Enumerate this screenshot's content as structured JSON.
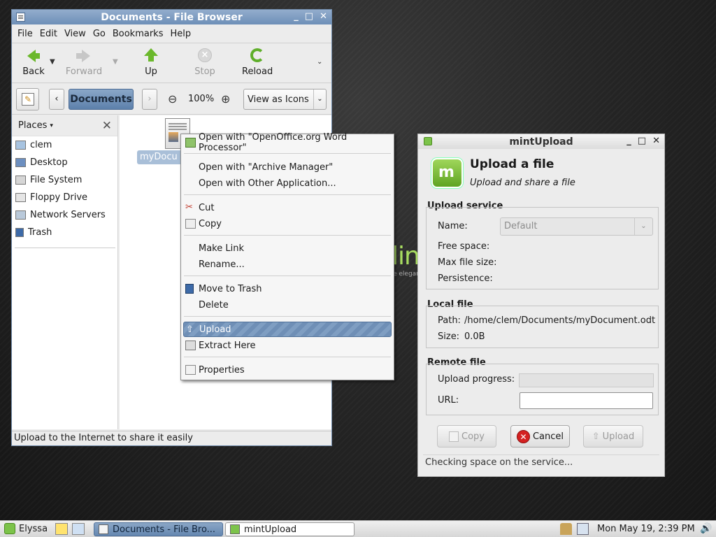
{
  "file_browser": {
    "title": "Documents - File Browser",
    "menu": [
      "File",
      "Edit",
      "View",
      "Go",
      "Bookmarks",
      "Help"
    ],
    "toolbar": {
      "back": "Back",
      "forward": "Forward",
      "up": "Up",
      "stop": "Stop",
      "reload": "Reload"
    },
    "location": {
      "crumb": "Documents",
      "zoom": "100%",
      "view_mode": "View as Icons"
    },
    "sidebar": {
      "header": "Places",
      "items": [
        "clem",
        "Desktop",
        "File System",
        "Floppy Drive",
        "Network Servers",
        "Trash"
      ]
    },
    "file": {
      "name": "myDocument.odt",
      "label_visible": "myDocu"
    },
    "status": "Upload to the Internet to share it easily"
  },
  "context_menu": {
    "items": [
      "Open with \"OpenOffice.org Word Processor\"",
      "Open with \"Archive Manager\"",
      "Open with Other Application...",
      "Cut",
      "Copy",
      "Make Link",
      "Rename...",
      "Move to Trash",
      "Delete",
      "Upload",
      "Extract Here",
      "Properties"
    ],
    "selected": "Upload"
  },
  "wallpaper": {
    "text": "lin",
    "tagline": "e elegan"
  },
  "mint_upload": {
    "title": "mintUpload",
    "heading": "Upload a file",
    "subheading": "Upload and share a file",
    "upload_service": {
      "title": "Upload service",
      "name_label": "Name:",
      "name_value": "Default",
      "free_space_label": "Free space:",
      "max_size_label": "Max file size:",
      "persistence_label": "Persistence:"
    },
    "local_file": {
      "title": "Local file",
      "path_label": "Path:",
      "path_value": "/home/clem/Documents/myDocument.odt",
      "size_label": "Size:",
      "size_value": "0.0B"
    },
    "remote_file": {
      "title": "Remote file",
      "progress_label": "Upload progress:",
      "progress_value": 0,
      "url_label": "URL:",
      "url_value": ""
    },
    "buttons": {
      "copy": "Copy",
      "cancel": "Cancel",
      "upload": "Upload"
    },
    "status": "Checking space on the service..."
  },
  "taskbar": {
    "menu_label": "Elyssa",
    "tasks": [
      "Documents - File Bro...",
      "mintUpload"
    ],
    "clock": "Mon May 19,  2:39 PM"
  },
  "colors": {
    "selection": "#6f8fb6",
    "titlebar": "#7d9cc2",
    "mint_green": "#7cc34a",
    "cancel_red": "#d42121"
  }
}
